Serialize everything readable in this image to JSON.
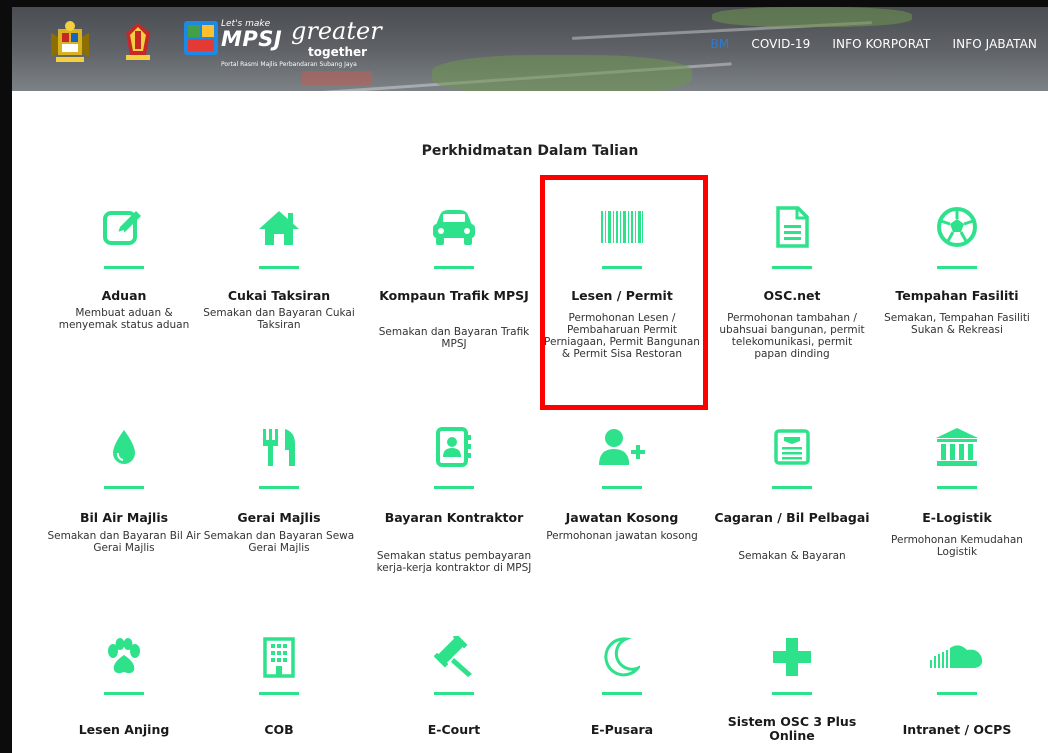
{
  "header": {
    "brand": {
      "tagline_top": "Let's make",
      "name": "MPSJ",
      "script": "greater",
      "script2": "together",
      "subtitle": "Portal Rasmi Majlis Perbandaran Subang Jaya"
    },
    "nav": [
      {
        "label": "BM",
        "active": true
      },
      {
        "label": "COVID-19",
        "active": false
      },
      {
        "label": "INFO KORPORAT",
        "active": false
      },
      {
        "label": "INFO JABATAN",
        "active": false
      }
    ]
  },
  "section": {
    "title": "Perkhidmatan Dalam Talian"
  },
  "accent_color": "#2ee28c",
  "highlight_color": "#ff0000",
  "services": [
    {
      "icon": "edit-icon",
      "title": "Aduan",
      "desc": "Membuat aduan & menyemak status aduan"
    },
    {
      "icon": "home-icon",
      "title": "Cukai Taksiran",
      "desc": "Semakan dan Bayaran Cukai Taksiran"
    },
    {
      "icon": "car-icon",
      "title": "Kompaun Trafik MPSJ",
      "desc": "Semakan dan Bayaran Trafik MPSJ"
    },
    {
      "icon": "barcode-icon",
      "title": "Lesen / Permit",
      "desc": "Permohonan Lesen / Pembaharuan Permit Perniagaan, Permit Bangunan & Permit Sisa Restoran"
    },
    {
      "icon": "document-icon",
      "title": "OSC.net",
      "desc": "Permohonan tambahan / ubahsuai bangunan, permit telekomunikasi, permit papan dinding"
    },
    {
      "icon": "soccer-ball-icon",
      "title": "Tempahan Fasiliti",
      "desc": "Semakan, Tempahan Fasiliti Sukan & Rekreasi"
    },
    {
      "icon": "water-drop-icon",
      "title": "Bil Air Majlis",
      "desc": "Semakan dan Bayaran Bil Air Gerai Majlis"
    },
    {
      "icon": "cutlery-icon",
      "title": "Gerai Majlis",
      "desc": "Semakan dan Bayaran Sewa Gerai Majlis"
    },
    {
      "icon": "contact-book-icon",
      "title": "Bayaran Kontraktor",
      "desc": "Semakan status pembayaran kerja-kerja kontraktor di MPSJ"
    },
    {
      "icon": "user-add-icon",
      "title": "Jawatan Kosong",
      "desc": "Permohonan jawatan kosong"
    },
    {
      "icon": "newspaper-icon",
      "title": "Cagaran / Bil Pelbagai",
      "desc": "Semakan & Bayaran"
    },
    {
      "icon": "institution-icon",
      "title": "E-Logistik",
      "desc": "Permohonan Kemudahan Logistik"
    },
    {
      "icon": "paw-icon",
      "title": "Lesen Anjing",
      "desc": ""
    },
    {
      "icon": "building-icon",
      "title": "COB",
      "desc": ""
    },
    {
      "icon": "gavel-icon",
      "title": "E-Court",
      "desc": ""
    },
    {
      "icon": "moon-icon",
      "title": "E-Pusara",
      "desc": ""
    },
    {
      "icon": "plus-icon",
      "title": "Sistem OSC 3 Plus Online",
      "desc": ""
    },
    {
      "icon": "soundcloud-icon",
      "title": "Intranet / OCPS",
      "desc": ""
    }
  ]
}
